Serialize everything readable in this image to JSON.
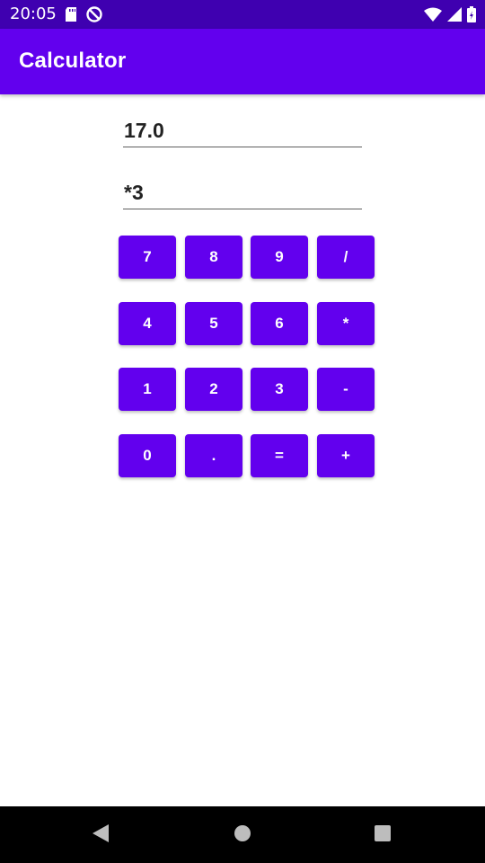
{
  "status_bar": {
    "time": "20:05",
    "icons": [
      "sd-card-icon",
      "do-not-disturb-icon",
      "wifi-icon",
      "signal-icon",
      "battery-icon"
    ]
  },
  "app_bar": {
    "title": "Calculator"
  },
  "display": {
    "result": "17.0",
    "expression": "*3"
  },
  "keypad": {
    "rows": [
      [
        "7",
        "8",
        "9",
        "/"
      ],
      [
        "4",
        "5",
        "6",
        "*"
      ],
      [
        "1",
        "2",
        "3",
        "-"
      ],
      [
        "0",
        ".",
        "=",
        "+"
      ]
    ]
  },
  "nav_bar": {
    "buttons": [
      "back-icon",
      "home-icon",
      "recents-icon"
    ]
  },
  "colors": {
    "status_bar": "#3f00b0",
    "primary": "#6200ee",
    "text": "#222222"
  }
}
